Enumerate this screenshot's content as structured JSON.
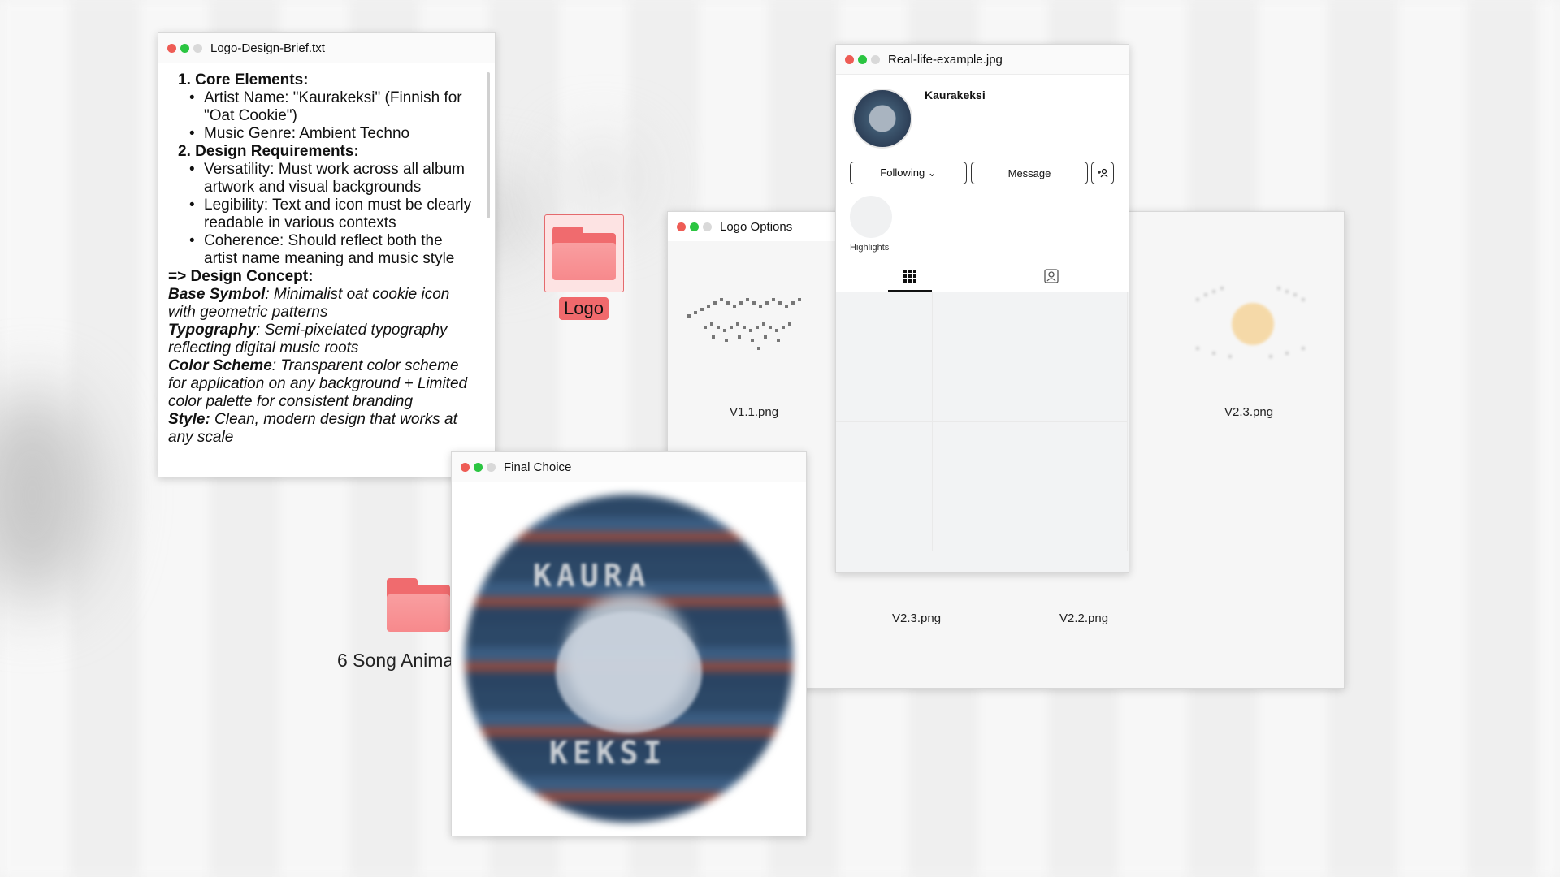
{
  "brief": {
    "title": "Logo-Design-Brief.txt",
    "h1": "1. Core Elements:",
    "b1": "Artist Name: \"Kaurakeksi\" (Finnish for \"Oat Cookie\")",
    "b2": "Music Genre: Ambient Techno",
    "h2": "2. Design Requirements:",
    "b3": "Versatility: Must work across all album artwork and visual backgrounds",
    "b4": "Legibility: Text and icon must be clearly readable in various contexts",
    "b5": "Coherence: Should reflect both the artist name meaning and music style",
    "concept": "=> Design Concept:",
    "l1k": "Base Symbol",
    "l1v": ": Minimalist oat cookie icon with geometric patterns",
    "l2k": "Typography",
    "l2v": ": Semi-pixelated typography reflecting digital music roots",
    "l3k": "Color Scheme",
    "l3v": ": Transparent color scheme for application on any background + Limited color palette for consistent branding",
    "l4k": "Style:",
    "l4v": " Clean, modern design that works at any scale"
  },
  "desktop": {
    "logo_folder_label": "Logo",
    "anim_folder_label": "6 Song Animations"
  },
  "options": {
    "title": "Logo Options",
    "thumbs": [
      "V1.1.png",
      "V2.3.png",
      "V2.3.png",
      "V2.2.png"
    ]
  },
  "reallife": {
    "title": "Real-life-example.jpg",
    "username": "Kaurakeksi",
    "following": "Following ⌄",
    "message": "Message",
    "highlights": "Highlights"
  },
  "final": {
    "title": "Final Choice",
    "top_text": "KAURA",
    "bottom_text": "KEKSI"
  }
}
